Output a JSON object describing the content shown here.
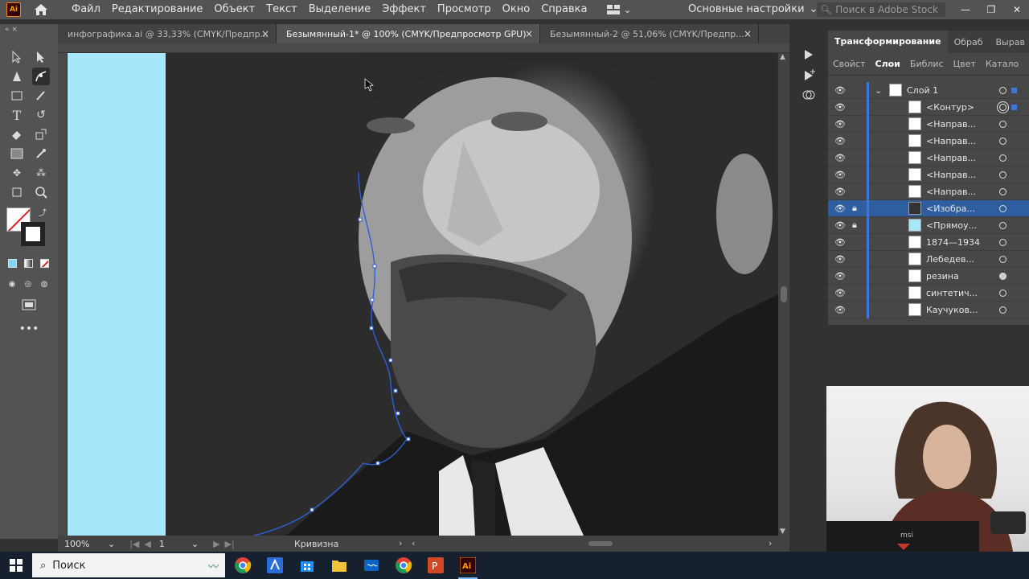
{
  "app": {
    "logo": "Ai"
  },
  "menu": [
    "Файл",
    "Редактирование",
    "Объект",
    "Текст",
    "Выделение",
    "Эффект",
    "Просмотр",
    "Окно",
    "Справка"
  ],
  "workspace": "Основные настройки",
  "stock_search": {
    "placeholder": "Поиск в Adobe Stock"
  },
  "tabs": [
    {
      "label": "инфографика.ai @ 33,33% (CMYK/Предпр...",
      "close": "×"
    },
    {
      "label": "Безымянный-1* @ 100% (CMYK/Предпросмотр GPU)",
      "close": "×"
    },
    {
      "label": "Безымянный-2 @ 51,06% (CMYK/Предпр...",
      "close": "×"
    }
  ],
  "status": {
    "zoom": "100%",
    "artboard": "1",
    "tool": "Кривизна"
  },
  "panel": {
    "tabs_top": [
      "Трансформирование",
      "Обраб",
      "Вырав"
    ],
    "tabs_second": [
      "Свойст",
      "Слои",
      "Библис",
      "Цвет",
      "Катало"
    ],
    "layers": [
      {
        "name": "Слой 1"
      },
      {
        "name": "<Контур>"
      },
      {
        "name": "<Направ..."
      },
      {
        "name": "<Направ..."
      },
      {
        "name": "<Направ..."
      },
      {
        "name": "<Направ..."
      },
      {
        "name": "<Направ..."
      },
      {
        "name": "<Изобра..."
      },
      {
        "name": "<Прямоу..."
      },
      {
        "name": "1874—1934"
      },
      {
        "name": "Лебедев..."
      },
      {
        "name": "резина"
      },
      {
        "name": "синтетич..."
      },
      {
        "name": "Каучуков..."
      }
    ]
  },
  "taskbar": {
    "search_label": "Поиск",
    "apps": [
      "chrome",
      "autocad",
      "store",
      "explorer",
      "photos",
      "chrome-2",
      "powerpoint",
      "illustrator"
    ]
  },
  "webcam": {
    "brand": "msi"
  },
  "colors": {
    "accent": "#3c76d6",
    "selected_layer": "#2f5e9e",
    "artboard_rect": "#a8e6fb",
    "path": "#2f5fd6"
  }
}
